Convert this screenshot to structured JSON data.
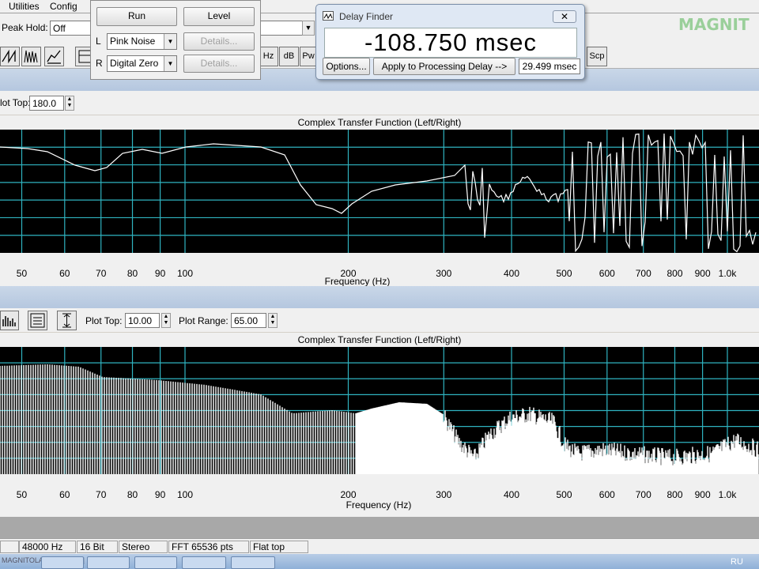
{
  "menu": {
    "utilities": "Utilities",
    "config": "Config"
  },
  "toolbar": {
    "peak_hold_label": "Peak Hold:",
    "peak_hold_value": "Off",
    "buttons": [
      "Hz",
      "dB",
      "Pw",
      "Scp"
    ]
  },
  "generator": {
    "run": "Run",
    "level": "Level",
    "left_label": "L",
    "right_label": "R",
    "left_signal": "Pink Noise",
    "right_signal": "Digital Zero",
    "details": "Details..."
  },
  "delay_finder": {
    "title": "Delay Finder",
    "value": "-108.750 msec",
    "options": "Options...",
    "apply": "Apply to Processing Delay -->",
    "processing_delay": "29.499 msec"
  },
  "logo_text": "MAGNIT",
  "top_plot": {
    "plot_top_label": "lot Top:",
    "plot_top_value": "180.0",
    "title": "Complex Transfer Function (Left/Right)",
    "x_title": "Frequency (Hz)"
  },
  "bottom_plot": {
    "plot_top_label": "Plot Top:",
    "plot_top_value": "10.00",
    "plot_range_label": "Plot Range:",
    "plot_range_value": "65.00",
    "title": "Complex Transfer Function (Left/Right)",
    "x_title": "Frequency (Hz)"
  },
  "x_ticks": [
    {
      "label": "50",
      "f": 50
    },
    {
      "label": "60",
      "f": 60
    },
    {
      "label": "70",
      "f": 70
    },
    {
      "label": "80",
      "f": 80
    },
    {
      "label": "90",
      "f": 90
    },
    {
      "label": "100",
      "f": 100
    },
    {
      "label": "200",
      "f": 200
    },
    {
      "label": "300",
      "f": 300
    },
    {
      "label": "400",
      "f": 400
    },
    {
      "label": "500",
      "f": 500
    },
    {
      "label": "600",
      "f": 600
    },
    {
      "label": "700",
      "f": 700
    },
    {
      "label": "800",
      "f": 800
    },
    {
      "label": "900",
      "f": 900
    },
    {
      "label": "1.0k",
      "f": 1000
    }
  ],
  "status": {
    "sample_rate": "48000 Hz",
    "bits": "16 Bit",
    "channels": "Stereo",
    "fft": "FFT 65536 pts",
    "window": "Flat top"
  },
  "taskbar": {
    "url_text": "MAGNITOLAE.ORG[I.RU] [.NET]",
    "lang": "RU"
  },
  "colors": {
    "plot_bg": "#000000",
    "grid": "#2fb3c0",
    "trace": "#ffffff"
  }
}
